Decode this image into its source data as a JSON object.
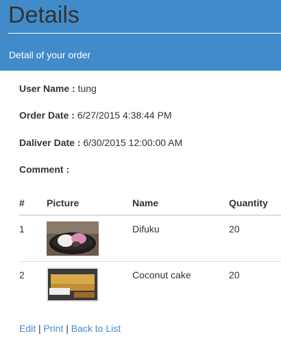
{
  "header": {
    "title": "Details",
    "subtitle": "Detail of your order"
  },
  "order": {
    "user_name_label": "User Name :",
    "user_name": "tung",
    "order_date_label": "Order Date :",
    "order_date": "6/27/2015 4:38:44 PM",
    "deliver_date_label": "Daliver Date :",
    "deliver_date": "6/30/2015 12:00:00 AM",
    "comment_label": "Comment :",
    "comment": ""
  },
  "table": {
    "headers": [
      "#",
      "Picture",
      "Name",
      "Quantity"
    ],
    "rows": [
      {
        "index": "1",
        "picture": "difuku-photo",
        "name": "Difuku",
        "quantity": "20"
      },
      {
        "index": "2",
        "picture": "coconut-cake-photo",
        "name": "Coconut cake",
        "quantity": "20"
      }
    ]
  },
  "links": {
    "edit": "Edit",
    "sep1": " | ",
    "print": "Print",
    "sep2": " | ",
    "back": "Back to List"
  },
  "colors": {
    "header_bg": "#428bca",
    "link": "#428bca",
    "text": "#333333"
  }
}
